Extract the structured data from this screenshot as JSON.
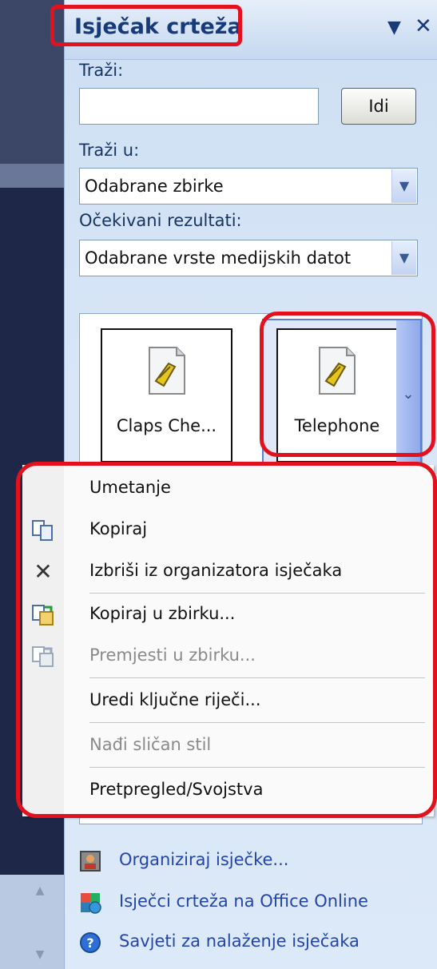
{
  "pane": {
    "title": "Isječak crteža",
    "dropdown_glyph": "▼",
    "close_glyph": "✕",
    "search_label": "Traži:",
    "search_value": "",
    "go_button": "Idi",
    "search_in_label": "Traži u:",
    "search_in_value": "Odabrane zbirke",
    "results_label": "Očekivani rezultati:",
    "results_value": "Odabrane vrste medijskih datot"
  },
  "results": {
    "items": [
      {
        "caption": "Claps Che..."
      },
      {
        "caption": "Telephone"
      }
    ]
  },
  "context_menu": {
    "items": [
      {
        "label": "Umetanje",
        "icon": "none",
        "enabled": true
      },
      {
        "label": "Kopiraj",
        "icon": "copy-icon",
        "enabled": true
      },
      {
        "label": "Izbriši iz organizatora isječaka",
        "icon": "delete-x-icon",
        "enabled": true
      },
      {
        "label": "Kopiraj u zbirku...",
        "icon": "copy-to-collection-icon",
        "enabled": true
      },
      {
        "label": "Premjesti u zbirku...",
        "icon": "move-to-collection-icon",
        "enabled": false
      },
      {
        "label": "Uredi ključne riječi...",
        "icon": "none",
        "enabled": true
      },
      {
        "label": "Nađi sličan stil",
        "icon": "none",
        "enabled": false
      },
      {
        "label": "Pretpregled/Svojstva",
        "icon": "none",
        "enabled": true
      }
    ]
  },
  "links": [
    {
      "label": "Organiziraj isječke...",
      "icon": "organizer-icon"
    },
    {
      "label": "Isječci crteža na Office Online",
      "icon": "office-online-icon"
    },
    {
      "label": "Savjeti za nalaženje isječaka",
      "icon": "help-icon"
    }
  ],
  "colors": {
    "highlight_red": "#e3101d",
    "pane_title": "#163a7a",
    "link_blue": "#2444a8"
  }
}
